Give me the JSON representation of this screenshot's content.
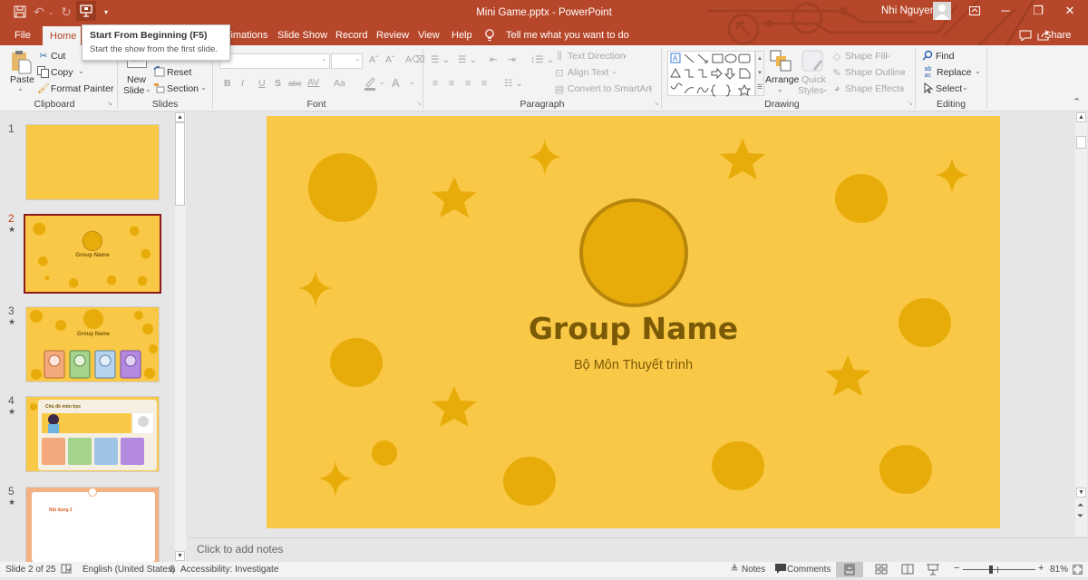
{
  "titlebar": {
    "document_title": "Mini Game.pptx  -  PowerPoint",
    "user_name": "Nhi Nguyen",
    "accent_color": "#b7472a",
    "quick_access": [
      {
        "name": "save-icon",
        "glyph": "🖫"
      },
      {
        "name": "undo-icon",
        "glyph": "↶"
      },
      {
        "name": "redo-icon",
        "glyph": "↻"
      },
      {
        "name": "start-from-beginning-icon",
        "glyph": "▣"
      },
      {
        "name": "customize-quick-access-icon",
        "glyph": "▾"
      }
    ],
    "window_buttons": {
      "ribbon_display": "⇪",
      "minimize": "─",
      "restore": "❐",
      "close": "✕"
    }
  },
  "tabs": [
    {
      "label": "File"
    },
    {
      "label": "Home",
      "active": true
    },
    {
      "label": "Animations"
    },
    {
      "label": "Slide Show"
    },
    {
      "label": "Record"
    },
    {
      "label": "Review"
    },
    {
      "label": "View"
    },
    {
      "label": "Help"
    }
  ],
  "tell_me": "Tell me what you want to do",
  "comments_icon": "☐",
  "share_label": "Share",
  "tooltip": {
    "title": "Start From Beginning (F5)",
    "description": "Start the show from the first slide."
  },
  "ribbon": {
    "clipboard": {
      "label": "Clipboard",
      "paste": "Paste",
      "cut": "Cut",
      "copy": "Copy",
      "format_painter": "Format Painter"
    },
    "slides": {
      "label": "Slides",
      "new_slide_1": "New",
      "new_slide_2": "Slide",
      "reset": "Reset",
      "section": "Section"
    },
    "font": {
      "label": "Font",
      "font_name": "",
      "font_size": "",
      "buttons": [
        "B",
        "I",
        "U",
        "S",
        "abc",
        "AV",
        "Aa",
        "A"
      ]
    },
    "paragraph": {
      "label": "Paragraph",
      "text_direction": "Text Direction",
      "align_text": "Align Text",
      "convert_smartart": "Convert to SmartArt"
    },
    "drawing": {
      "label": "Drawing",
      "arrange": "Arrange",
      "quick_styles_1": "Quick",
      "quick_styles_2": "Styles",
      "shape_fill": "Shape Fill",
      "shape_outline": "Shape Outline",
      "shape_effects": "Shape Effects"
    },
    "editing": {
      "label": "Editing",
      "find": "Find",
      "replace": "Replace",
      "select": "Select"
    }
  },
  "thumbnails": [
    {
      "number": "1",
      "selected": false,
      "animated": false
    },
    {
      "number": "2",
      "selected": true,
      "animated": true,
      "title": "Group Name"
    },
    {
      "number": "3",
      "selected": false,
      "animated": true,
      "title": "Group Name"
    },
    {
      "number": "4",
      "selected": false,
      "animated": true,
      "title": "Chủ đề môn học"
    },
    {
      "number": "5",
      "selected": false,
      "animated": true,
      "title": "Nội dung 1"
    }
  ],
  "slide": {
    "title": "Group Name",
    "subtitle": "Bộ Môn Thuyết trình",
    "background_color": "#f9c846",
    "shape_color": "#e8ac0a",
    "title_color": "#7a5a06"
  },
  "notes_placeholder": "Click to add notes",
  "status": {
    "slide_indicator": "Slide 2 of 25",
    "language": "English (United States)",
    "accessibility": "Accessibility: Investigate",
    "notes": "Notes",
    "comments": "Comments",
    "zoom_minus": "−",
    "zoom_plus": "+",
    "zoom_level": "81%"
  }
}
